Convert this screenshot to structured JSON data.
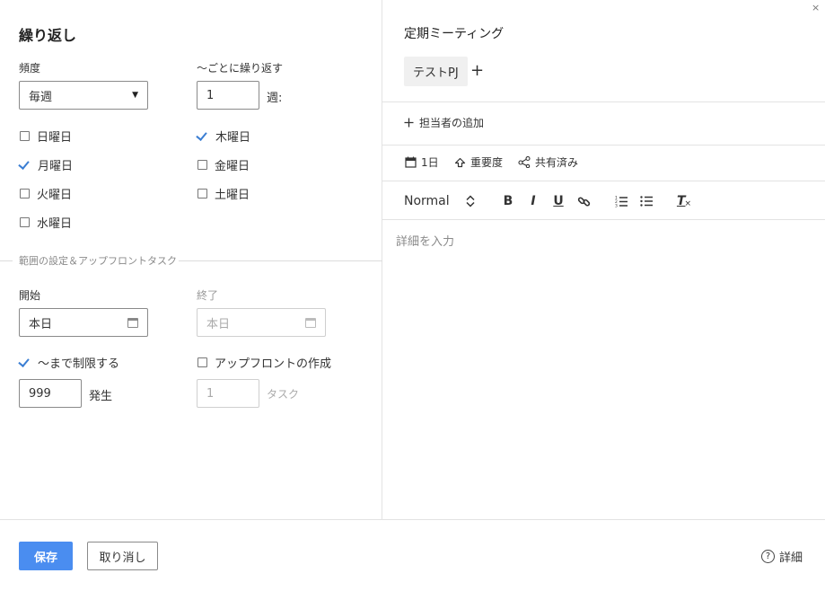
{
  "left": {
    "title": "繰り返し",
    "frequency": {
      "label": "頻度",
      "value": "毎週"
    },
    "interval": {
      "label": "〜ごとに繰り返す",
      "value": "1",
      "unit": "週:"
    },
    "weekdays": [
      {
        "label": "日曜日",
        "checked": false
      },
      {
        "label": "月曜日",
        "checked": true
      },
      {
        "label": "火曜日",
        "checked": false
      },
      {
        "label": "水曜日",
        "checked": false
      },
      {
        "label": "木曜日",
        "checked": true
      },
      {
        "label": "金曜日",
        "checked": false
      },
      {
        "label": "土曜日",
        "checked": false
      }
    ],
    "section_title": "範囲の設定＆アップフロントタスク",
    "start": {
      "label": "開始",
      "value": "本日"
    },
    "end": {
      "label": "終了",
      "value": "本日"
    },
    "limit": {
      "label": "〜まで制限する",
      "checked": true,
      "value": "999",
      "unit": "発生"
    },
    "upfront": {
      "label": "アップフロントの作成",
      "checked": false,
      "value": "1",
      "unit": "タスク"
    }
  },
  "right": {
    "title": "定期ミーティング",
    "close_icon": "×",
    "project_tag": "テストPJ",
    "add_tag": "+",
    "add_assignee": "担当者の追加",
    "duration": "1日",
    "priority": "重要度",
    "shared": "共有済み",
    "toolbar": {
      "style": "Normal",
      "bold": "B",
      "italic": "I",
      "underline": "U",
      "clear": "T"
    },
    "details_placeholder": "詳細を入力"
  },
  "footer": {
    "save": "保存",
    "cancel": "取り消し",
    "details": "詳細",
    "help_icon": "?"
  },
  "colors": {
    "accent": "#4a8df0",
    "check": "#3b7ed3"
  }
}
